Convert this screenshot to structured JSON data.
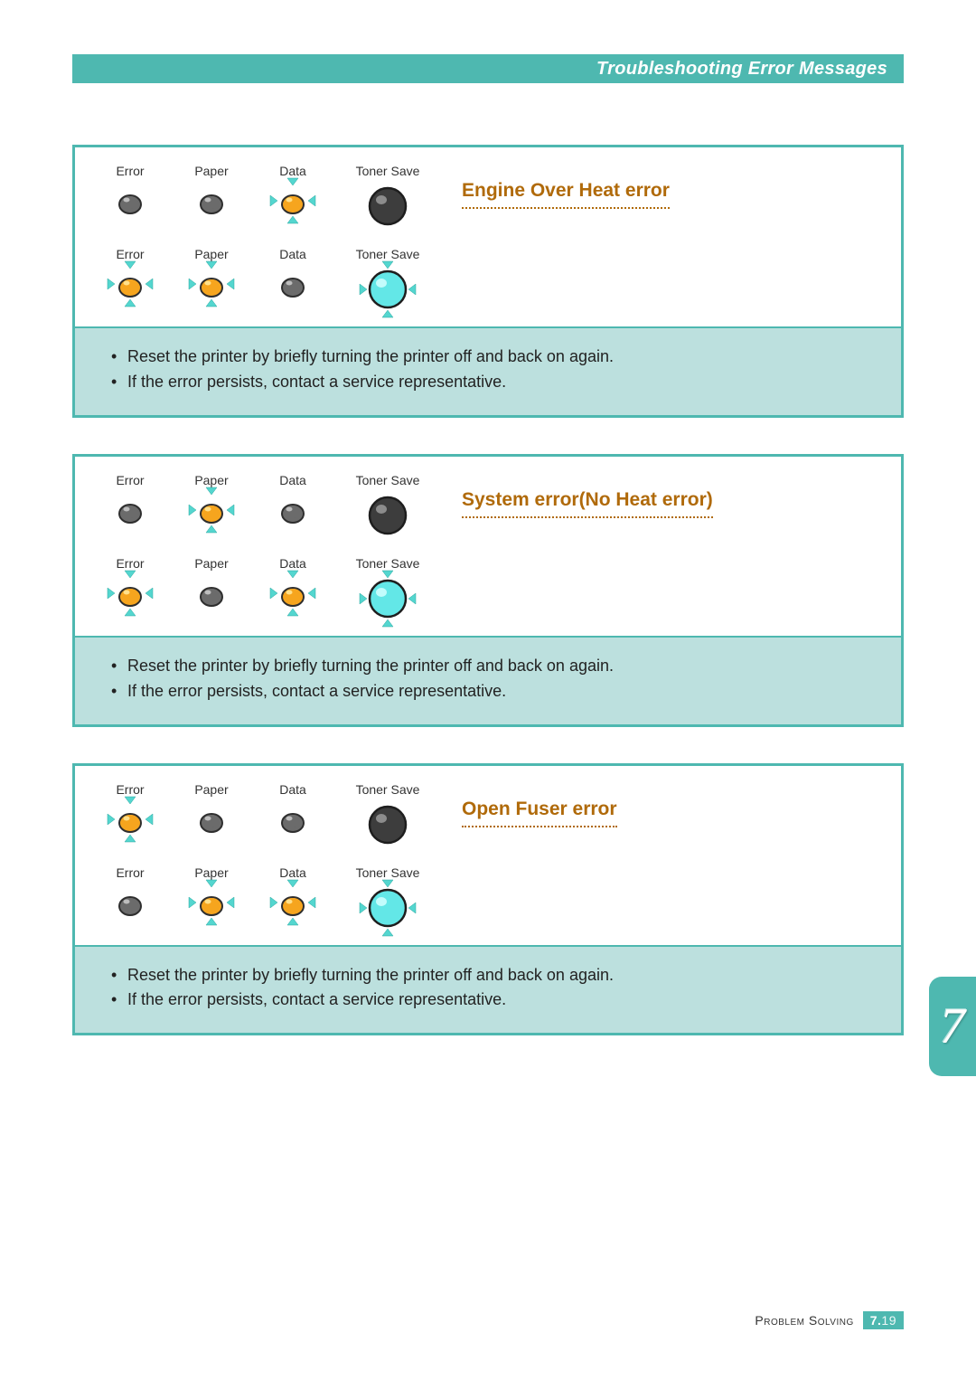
{
  "header": {
    "title": "Troubleshooting Error Messages"
  },
  "labels": {
    "error": "Error",
    "paper": "Paper",
    "data": "Data",
    "toner": "Toner Save"
  },
  "errors": [
    {
      "title": "Engine Over Heat error",
      "rows": [
        {
          "error": {
            "on": true,
            "blink": false
          },
          "paper": {
            "on": true,
            "blink": false
          },
          "data": {
            "on": true,
            "blink": true,
            "lit": true
          },
          "toner": {
            "big": true,
            "dark": true,
            "blink": false
          }
        },
        {
          "error": {
            "on": true,
            "blink": true,
            "lit": true
          },
          "paper": {
            "on": true,
            "blink": true,
            "lit": true
          },
          "data": {
            "on": true,
            "blink": false
          },
          "toner": {
            "big": true,
            "cyan": true,
            "blink": true
          }
        }
      ],
      "steps": [
        "Reset the printer by briefly turning the printer off and back on again.",
        "If the error persists, contact a service representative."
      ]
    },
    {
      "title": "System error(No Heat error)",
      "rows": [
        {
          "error": {
            "on": true,
            "blink": false
          },
          "paper": {
            "on": true,
            "blink": true,
            "lit": true
          },
          "data": {
            "on": true,
            "blink": false
          },
          "toner": {
            "big": true,
            "dark": true,
            "blink": false
          }
        },
        {
          "error": {
            "on": true,
            "blink": true,
            "lit": true
          },
          "paper": {
            "on": true,
            "blink": false
          },
          "data": {
            "on": true,
            "blink": true,
            "lit": true
          },
          "toner": {
            "big": true,
            "cyan": true,
            "blink": true
          }
        }
      ],
      "steps": [
        "Reset the printer by briefly turning the printer off and back on again.",
        "If the error persists, contact a service representative."
      ]
    },
    {
      "title": "Open Fuser error",
      "rows": [
        {
          "error": {
            "on": true,
            "blink": true,
            "lit": true
          },
          "paper": {
            "on": true,
            "blink": false
          },
          "data": {
            "on": true,
            "blink": false
          },
          "toner": {
            "big": true,
            "dark": true,
            "blink": false
          }
        },
        {
          "error": {
            "on": true,
            "blink": false
          },
          "paper": {
            "on": true,
            "blink": true,
            "lit": true
          },
          "data": {
            "on": true,
            "blink": true,
            "lit": true
          },
          "toner": {
            "big": true,
            "cyan": true,
            "blink": true
          }
        }
      ],
      "steps": [
        "Reset the printer by briefly turning the printer off and back on again.",
        "If the error persists, contact a service representative."
      ]
    }
  ],
  "footer": {
    "section": "Problem Solving",
    "chapter": "7",
    "page": "19"
  },
  "tab": {
    "chapter": "7"
  }
}
